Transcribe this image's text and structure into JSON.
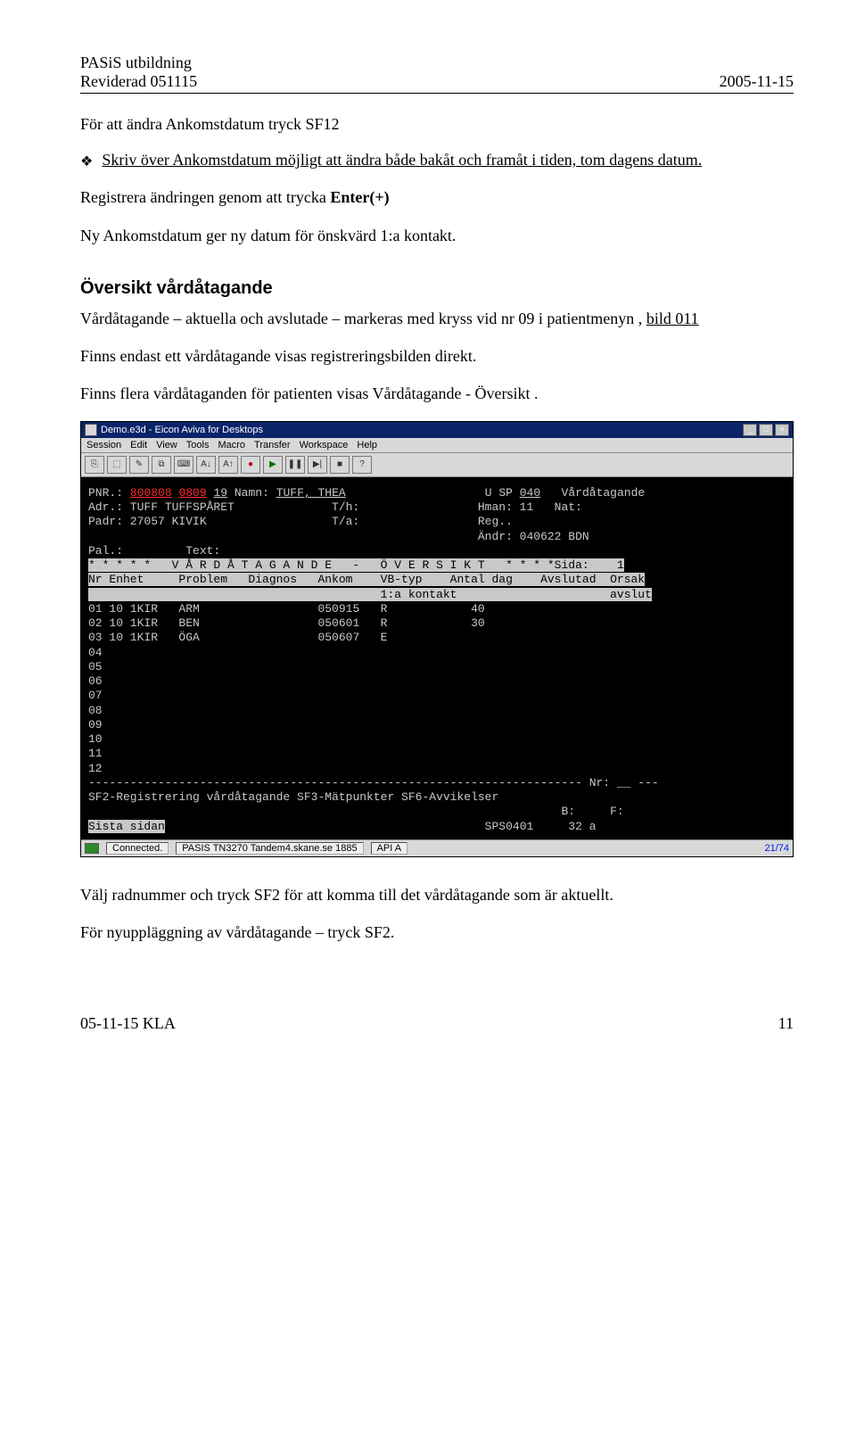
{
  "header": {
    "title": "PASiS utbildning",
    "revised": "Reviderad 051115",
    "date": "2005-11-15"
  },
  "h1": "För att ändra Ankomstdatum tryck SF12",
  "bullet1": "Skriv över Ankomstdatum möjligt att ändra både bakåt och framåt i tiden, tom dagens datum.",
  "p2_a": "Registrera ändringen genom att trycka ",
  "p2_b": "Enter(+)",
  "p3": "Ny Ankomstdatum ger ny datum för önskvärd 1:a kontakt.",
  "section2_title": "Översikt vårdåtagande",
  "p4_a": "Vårdåtagande – aktuella och avslutade – markeras med kryss vid nr 09 i patientmenyn , ",
  "p4_b": "bild 011",
  "p5": "Finns endast ett vårdåtagande visas registreringsbilden direkt.",
  "p6": "Finns flera vårdåtaganden för patienten visas Vårdåtagande - Översikt .",
  "p7": "Välj radnummer och tryck SF2 för att komma till det vårdåtagande som är aktuellt.",
  "p8": "För nyuppläggning av vårdåtagande – tryck SF2.",
  "footer_left": "05-11-15 KLA",
  "footer_right": "11",
  "term": {
    "title": "Demo.e3d - Eicon Aviva for Desktops",
    "menus": [
      "Session",
      "Edit",
      "View",
      "Tools",
      "Macro",
      "Transfer",
      "Workspace",
      "Help"
    ],
    "status": {
      "connected": "Connected.",
      "host": "PASIS  TN3270  Tandem4.skane.se  1885",
      "api": "API A",
      "pos": "21/74"
    },
    "screen": {
      "l1_a": "PNR.: ",
      "l1_pnr1": "800808",
      "l1_pnr2": "0809",
      "l1_pnr3": "19",
      "l1_b": " Namn: ",
      "l1_name": "TUFF, THEA",
      "l1_c": "                    U SP ",
      "l1_code": "040",
      "l1_d": "   Vårdåtagande",
      "l2": "Adr.: TUFF TUFFSPÅRET              T/h:                 Hman: 11   Nat:",
      "l3": "Padr: 27057 KIVIK                  T/a:                 Reg..",
      "l4": "                                                        Ändr: 040622 BDN",
      "l5": "Pal.:         Text:",
      "inv1": "* * * * *   V Å R D Å T A G A N D E   -   Ö V E R S I K T   * * * *Sida:    1",
      "inv2": "Nr Enhet     Problem   Diagnos   Ankom    VB-typ    Antal dag    Avslutad  Orsak",
      "inv3": "                                          1:a kontakt                      avslut",
      "r01": "01 10 1KIR   ARM                 050915   R            40",
      "r02": "02 10 1KIR   BEN                 050601   R            30",
      "r03": "03 10 1KIR   ÖGA                 050607   E",
      "r04": "04",
      "r05": "05",
      "r06": "06",
      "r07": "07",
      "r08": "08",
      "r09": "09",
      "r10": "10",
      "r11": "11",
      "r12": "12",
      "dash": "----------------------------------------------------------------------- Nr: __ ---",
      "fn": "SF2-Registrering vårdåtagande SF3-Mätpunkter SF6-Avvikelser",
      "foot_a": "Sista sidan",
      "foot_b": "                                              SPS0401     32 a"
    }
  }
}
